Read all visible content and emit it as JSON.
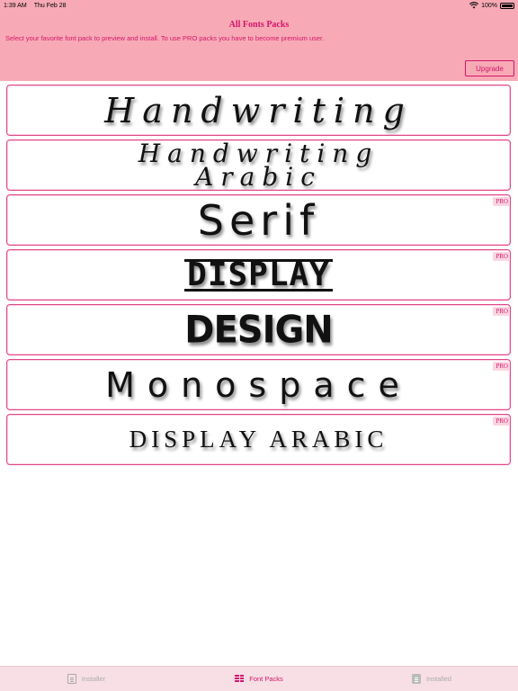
{
  "status_bar": {
    "time": "1:39 AM",
    "date": "Thu Feb 28",
    "battery": "100%"
  },
  "header": {
    "title": "All Fonts Packs",
    "subtitle": "Select your favorite font pack to preview and install. To use PRO packs you have to become premium user.",
    "upgrade_label": "Upgrade"
  },
  "packs": [
    {
      "preview": "Handwriting",
      "pro": false
    },
    {
      "preview_line1": "Handwriting",
      "preview_line2": "Arabic",
      "pro": false
    },
    {
      "preview": "Serif",
      "pro": true,
      "badge": "PRO"
    },
    {
      "preview": "DISPLAY",
      "pro": true,
      "badge": "PRO"
    },
    {
      "preview": "DESIGN",
      "pro": true,
      "badge": "PRO"
    },
    {
      "preview": "Monospace",
      "pro": true,
      "badge": "PRO"
    },
    {
      "preview": "DISPLAY ARABIC",
      "pro": true,
      "badge": "PRO"
    }
  ],
  "tabs": [
    {
      "label": "Installer",
      "icon": "list-icon",
      "active": false
    },
    {
      "label": "Font Packs",
      "icon": "grid-list-icon",
      "active": true
    },
    {
      "label": "Installed",
      "icon": "installed-list-icon",
      "active": false
    }
  ],
  "colors": {
    "header_bg": "#f7aab6",
    "accent": "#d4156b",
    "card_border": "#e0468a",
    "tab_bar_bg": "#f7dfe5"
  }
}
